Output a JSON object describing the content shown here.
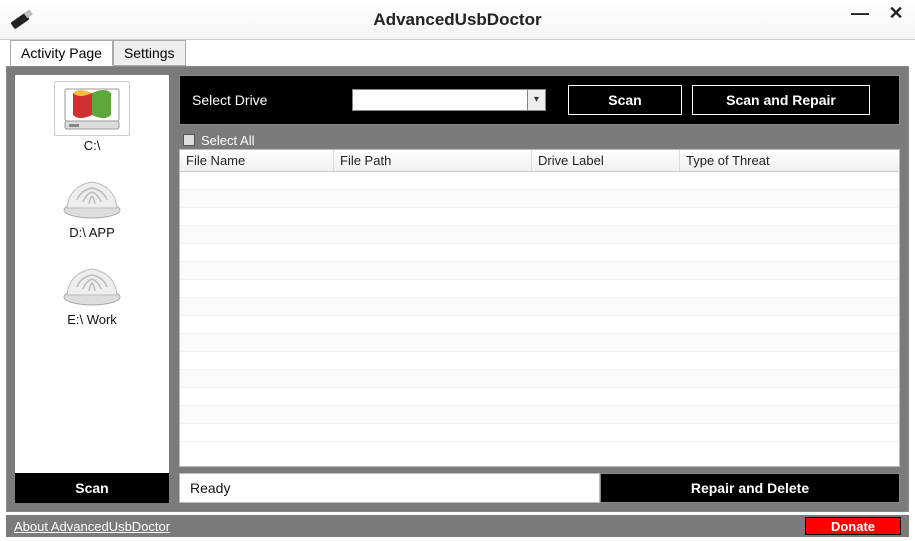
{
  "window": {
    "title": "AdvancedUsbDoctor"
  },
  "tabs": {
    "activity": "Activity Page",
    "settings": "Settings"
  },
  "drives": [
    {
      "label": "C:\\"
    },
    {
      "label": "D:\\ APP"
    },
    {
      "label": "E:\\ Work"
    }
  ],
  "sidebar": {
    "scan_label": "Scan"
  },
  "topbar": {
    "select_drive_label": "Select Drive",
    "scan_label": "Scan",
    "scan_repair_label": "Scan and Repair"
  },
  "table": {
    "select_all_label": "Select All",
    "columns": {
      "file_name": "File Name",
      "file_path": "File Path",
      "drive_label": "Drive Label",
      "threat_type": "Type of Threat"
    }
  },
  "status": {
    "text": "Ready",
    "repair_delete_label": "Repair and Delete"
  },
  "footer": {
    "about_label": "About AdvancedUsbDoctor",
    "donate_label": "Donate"
  }
}
